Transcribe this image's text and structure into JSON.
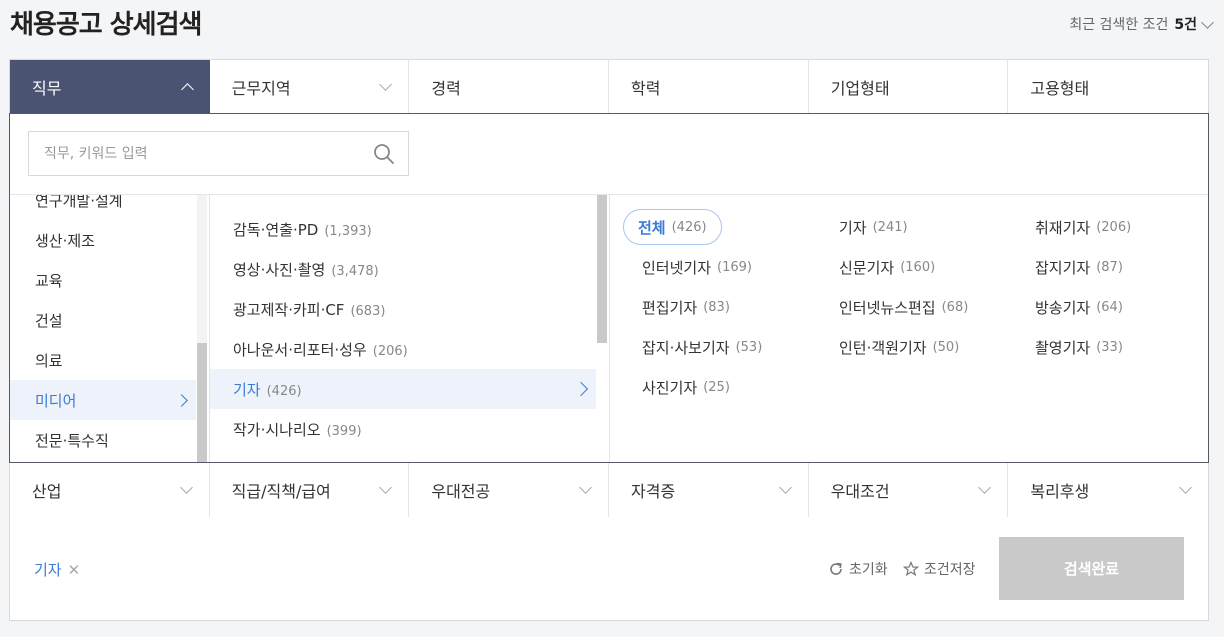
{
  "page": {
    "title": "채용공고 상세검색"
  },
  "recent": {
    "label": "최근 검색한 조건",
    "count": "5건"
  },
  "tabs_top": [
    {
      "label": "직무"
    },
    {
      "label": "근무지역"
    },
    {
      "label": "경력"
    },
    {
      "label": "학력"
    },
    {
      "label": "기업형태"
    },
    {
      "label": "고용형태"
    }
  ],
  "search": {
    "placeholder": "직무, 키워드 입력"
  },
  "categories": [
    {
      "label": "연구개발·설계"
    },
    {
      "label": "생산·제조"
    },
    {
      "label": "교육"
    },
    {
      "label": "건설"
    },
    {
      "label": "의료"
    },
    {
      "label": "미디어"
    },
    {
      "label": "전문·특수직"
    }
  ],
  "subcategories": [
    {
      "label": "감독·연출·PD",
      "count": "(1,393)"
    },
    {
      "label": "영상·사진·촬영",
      "count": "(3,478)"
    },
    {
      "label": "광고제작·카피·CF",
      "count": "(683)"
    },
    {
      "label": "아나운서·리포터·성우",
      "count": "(206)"
    },
    {
      "label": "기자",
      "count": "(426)"
    },
    {
      "label": "작가·시나리오",
      "count": "(399)"
    }
  ],
  "jobs": [
    {
      "label": "전체",
      "count": "(426)"
    },
    {
      "label": "기자",
      "count": "(241)"
    },
    {
      "label": "취재기자",
      "count": "(206)"
    },
    {
      "label": "인터넷기자",
      "count": "(169)"
    },
    {
      "label": "신문기자",
      "count": "(160)"
    },
    {
      "label": "잡지기자",
      "count": "(87)"
    },
    {
      "label": "편집기자",
      "count": "(83)"
    },
    {
      "label": "인터넷뉴스편집",
      "count": "(68)"
    },
    {
      "label": "방송기자",
      "count": "(64)"
    },
    {
      "label": "잡지·사보기자",
      "count": "(53)"
    },
    {
      "label": "인턴·객원기자",
      "count": "(50)"
    },
    {
      "label": "촬영기자",
      "count": "(33)"
    },
    {
      "label": "사진기자",
      "count": "(25)"
    }
  ],
  "tabs_bottom": [
    {
      "label": "산업"
    },
    {
      "label": "직급/직책/급여"
    },
    {
      "label": "우대전공"
    },
    {
      "label": "자격증"
    },
    {
      "label": "우대조건"
    },
    {
      "label": "복리후생"
    }
  ],
  "footer": {
    "selected_chip": "기자",
    "reset_label": "초기화",
    "save_label": "조건저장",
    "complete_label": "검색완료"
  },
  "colors": {
    "active_tab": "#4a5372",
    "accent": "#3a7bd5",
    "disabled_button": "#c9c9c9"
  }
}
